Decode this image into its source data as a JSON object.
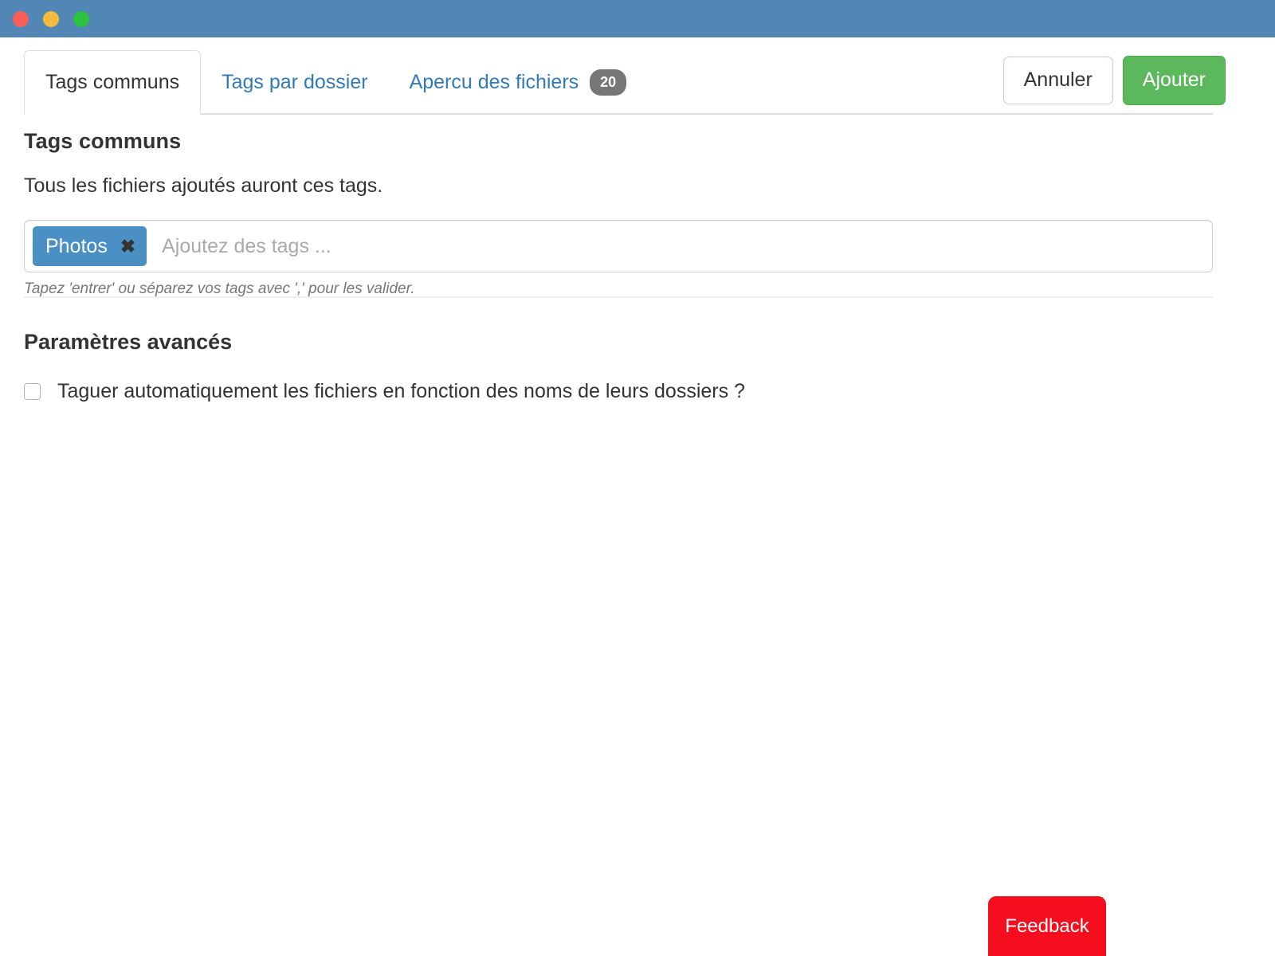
{
  "window": {
    "titlebar_color": "#5286b4",
    "traffic_lights": [
      {
        "name": "close",
        "color": "#fa5e57"
      },
      {
        "name": "minimize",
        "color": "#f7ba3e"
      },
      {
        "name": "maximize",
        "color": "#2ac33f"
      }
    ]
  },
  "tabs": [
    {
      "label": "Tags communs",
      "active": true
    },
    {
      "label": "Tags par dossier",
      "active": false
    },
    {
      "label": "Apercu des fichiers",
      "active": false,
      "badge": "20"
    }
  ],
  "header": {
    "cancel_label": "Annuler",
    "add_label": "Ajouter"
  },
  "common_tags": {
    "title": "Tags communs",
    "description": "Tous les fichiers ajoutés auront ces tags.",
    "tags": [
      {
        "label": "Photos",
        "remove_icon": "✖"
      }
    ],
    "input_placeholder": "Ajoutez des tags ...",
    "help_text": "Tapez 'entrer' ou séparez vos tags avec ',' pour les valider."
  },
  "advanced": {
    "title": "Paramètres avancés",
    "auto_tag_label": "Taguer automatiquement les fichiers en fonction des noms de leurs dossiers ?",
    "auto_tag_checked": false
  },
  "feedback": {
    "label": "Feedback",
    "color": "#f50f1e"
  },
  "colors": {
    "accent_blue": "#337ab7",
    "tag_blue": "#4a90c4",
    "success_green": "#5cb85c",
    "badge_gray": "#777777",
    "titlebar": "#5286b4"
  }
}
